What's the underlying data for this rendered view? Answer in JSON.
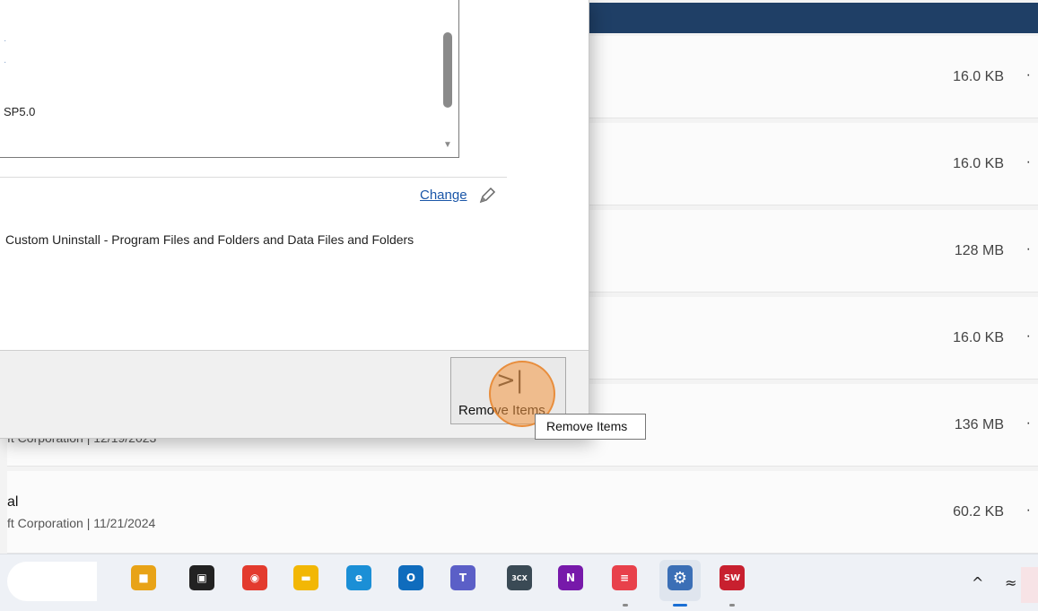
{
  "window": {
    "topbar_color": "#1f3f66"
  },
  "background_rows": [
    {
      "size": "16.0 KB",
      "more": "·"
    },
    {
      "size": "16.0 KB",
      "more": "·"
    },
    {
      "size": "128 MB",
      "more": "·"
    },
    {
      "size": "16.0 KB",
      "more": "·"
    },
    {
      "size": "136 MB",
      "more": "·",
      "meta": "ft Corporation  |  12/19/2023"
    },
    {
      "size": "60.2 KB",
      "more": "·",
      "name": "al",
      "meta": "ft Corporation  |  11/21/2024"
    }
  ],
  "dialog": {
    "list_items": [
      "SP5.0"
    ],
    "change_link": "Change",
    "description": "Custom Uninstall - Program Files and Folders and Data Files and Folders",
    "remove_button_label": "Remove Items",
    "remove_button_glyph": ">|",
    "tooltip": "Remove Items"
  },
  "taskbar": {
    "apps": [
      {
        "name": "briefcase-icon",
        "glyph": "■",
        "color": "#e8a317"
      },
      {
        "name": "task-view-icon",
        "glyph": "▣",
        "color": "#222222"
      },
      {
        "name": "chrome-icon",
        "glyph": "◉",
        "color": "#e33b2e"
      },
      {
        "name": "file-explorer-icon",
        "glyph": "▬",
        "color": "#f2b705"
      },
      {
        "name": "edge-icon",
        "glyph": "e",
        "color": "#1b8fd6"
      },
      {
        "name": "outlook-icon",
        "glyph": "O",
        "color": "#0f6cbd"
      },
      {
        "name": "teams-icon",
        "glyph": "T",
        "color": "#5b5fc7"
      },
      {
        "name": "3cx-icon",
        "glyph": "3CX",
        "color": "#3a4a55"
      },
      {
        "name": "onenote-icon",
        "glyph": "N",
        "color": "#7719aa"
      },
      {
        "name": "app-red-icon",
        "glyph": "≡",
        "color": "#e8414b"
      },
      {
        "name": "settings-icon",
        "glyph": "⚙",
        "color": "#3b6fb6"
      },
      {
        "name": "solidworks-icon",
        "glyph": "SW",
        "color": "#c8202f"
      }
    ],
    "tray": {
      "chevron": "^",
      "wifi": "≈"
    }
  }
}
